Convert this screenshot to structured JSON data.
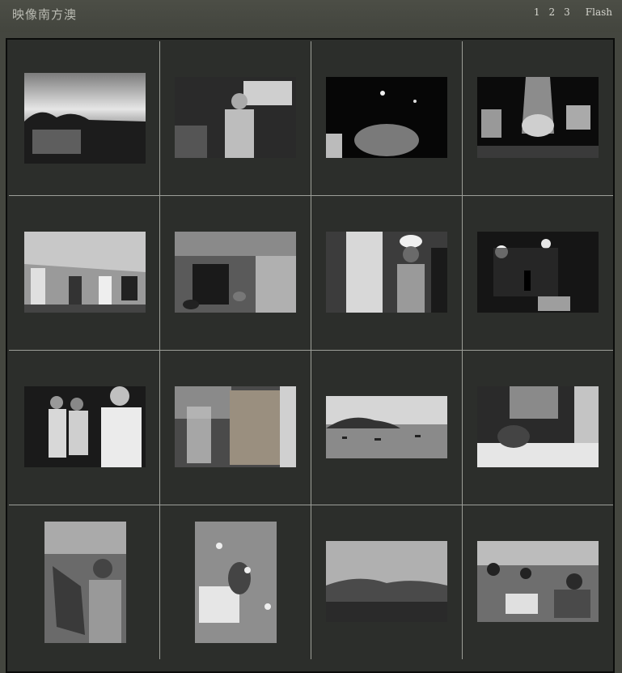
{
  "header": {
    "title": "映像南方澳",
    "pages": [
      "1",
      "2",
      "3"
    ],
    "flash_label": "Flash"
  },
  "gallery": {
    "thumbnails": [
      {
        "subject": "harbor town under clouds"
      },
      {
        "subject": "fisherman in boat cabin"
      },
      {
        "subject": "night fishing catch on deck"
      },
      {
        "subject": "crew hauling net at night"
      },
      {
        "subject": "workers resting under tarp"
      },
      {
        "subject": "fish market baskets"
      },
      {
        "subject": "worker in white hard hat"
      },
      {
        "subject": "dark cold storage room"
      },
      {
        "subject": "group of older men"
      },
      {
        "subject": "worker carrying fish rack"
      },
      {
        "subject": "boats in the bay"
      },
      {
        "subject": "man lying on pillow"
      },
      {
        "subject": "man holding large fish"
      },
      {
        "subject": "aerial view of dock crates"
      },
      {
        "subject": "misty coastline"
      },
      {
        "subject": "crowded fish auction"
      }
    ]
  }
}
